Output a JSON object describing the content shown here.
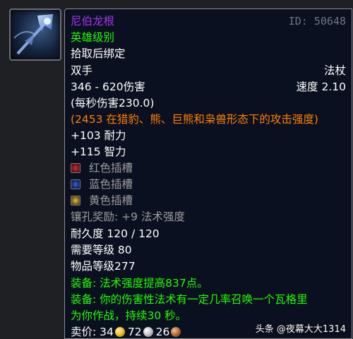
{
  "item": {
    "name": "尼伯龙根",
    "id_label": "ID: 50648",
    "quality": "英雄级别",
    "bind": "拾取后绑定",
    "slot": "双手",
    "type": "法杖",
    "damage": "346 - 620伤害",
    "speed": "速度 2.10",
    "dps": "(每秒伤害230.0)",
    "feral_ap": "(2453 在猎豹、熊、巨熊和枭兽形态下的攻击强度)",
    "stat_stamina": "+103 耐力",
    "stat_intellect": "+115 智力",
    "sockets": [
      {
        "label": "红色插槽",
        "color": "#b3262a"
      },
      {
        "label": "蓝色插槽",
        "color": "#2b4fbf"
      },
      {
        "label": "黄色插槽",
        "color": "#c9a623"
      }
    ],
    "socket_bonus": "镶孔奖励: +9 法术强度",
    "durability": "耐久度 120 / 120",
    "required_level": "需要等级 80",
    "item_level": "物品等级277",
    "equip1": "装备:  法术强度提高837点。",
    "equip2_line1": "装备:  你的伤害性法术有一定几率召唤一个瓦格里",
    "equip2_line2": "为你作战，持续30 秒。",
    "sell_label": "卖价: ",
    "sell_gold": "34",
    "sell_silver": "72",
    "sell_copper": "26"
  },
  "watermark": "头条 @夜幕大大1314",
  "colors": {
    "epic": "#a335ee",
    "uncommon": "#1eff00",
    "orange": "#ff8000",
    "gray": "#9d9d9d",
    "gold": "#f2c12e",
    "silver": "#c7c7c7",
    "copper": "#b8733a"
  }
}
